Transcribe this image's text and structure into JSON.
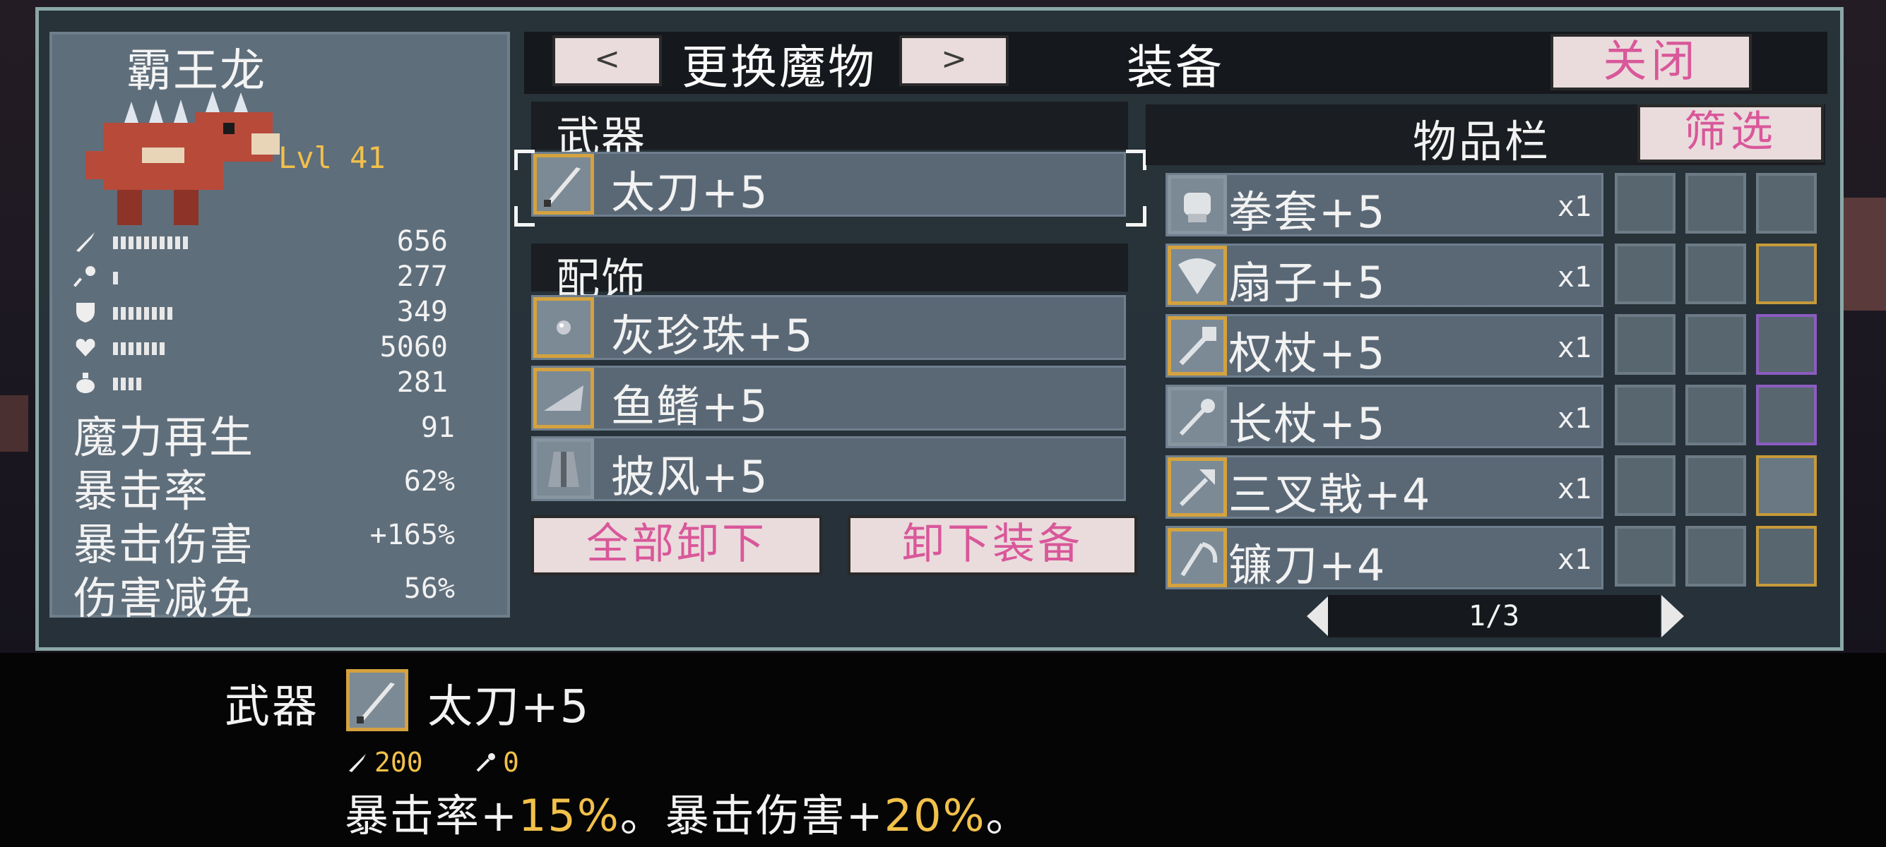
{
  "monster": {
    "name": "霸王龙",
    "level": "Lvl 41",
    "stats": [
      {
        "icon": "sword-icon",
        "value": "656",
        "bar_fraction": 0.55
      },
      {
        "icon": "staff-icon",
        "value": "277",
        "bar_fraction": 0.07
      },
      {
        "icon": "shield-icon",
        "value": "349",
        "bar_fraction": 0.45
      },
      {
        "icon": "heart-icon",
        "value": "5060",
        "bar_fraction": 0.38
      },
      {
        "icon": "potion-icon",
        "value": "281",
        "bar_fraction": 0.2
      }
    ],
    "extra": [
      {
        "label": "魔力再生",
        "value": "91"
      },
      {
        "label": "暴击率",
        "value": "62%"
      },
      {
        "label": "暴击伤害",
        "value": "+165%"
      },
      {
        "label": "伤害减免",
        "value": "56%"
      }
    ]
  },
  "topbar": {
    "prev": "<",
    "swap": "更换魔物",
    "next": ">",
    "title": "装备",
    "close": "关闭"
  },
  "equipment": {
    "weapon_header": "武器",
    "weapon": {
      "name": "太刀+5",
      "icon": "katana-icon"
    },
    "accessory_header": "配饰",
    "accessories": [
      {
        "name": "灰珍珠+5",
        "icon": "pearl-icon"
      },
      {
        "name": "鱼鳍+5",
        "icon": "fin-icon"
      },
      {
        "name": "披风+5",
        "icon": "cape-icon"
      }
    ],
    "unequip_all": "全部卸下",
    "unequip": "卸下装备"
  },
  "inventory": {
    "label": "物品栏",
    "filter": "筛选",
    "items": [
      {
        "name": "拳套+5",
        "qty": "x1",
        "icon": "gauntlet-icon",
        "gold": false
      },
      {
        "name": "扇子+5",
        "qty": "x1",
        "icon": "fan-icon",
        "gold": true
      },
      {
        "name": "权杖+5",
        "qty": "x1",
        "icon": "scepter-icon",
        "gold": true
      },
      {
        "name": "长杖+5",
        "qty": "x1",
        "icon": "staff-icon",
        "gold": false
      },
      {
        "name": "三叉戟+4",
        "qty": "x1",
        "icon": "trident-icon",
        "gold": true
      },
      {
        "name": "镰刀+4",
        "qty": "x1",
        "icon": "scythe-icon",
        "gold": true
      }
    ],
    "page": "1/3"
  },
  "detail": {
    "category": "武器",
    "name": "太刀+5",
    "attack": "200",
    "magic": "0",
    "desc_part1": "暴击率+",
    "desc_val1": "15%",
    "desc_part2": "。暴击伤害+",
    "desc_val2": "20%",
    "desc_part3": "。"
  },
  "colors": {
    "accent_pink": "#d9579a",
    "gold_border": "#d4a23e",
    "highlight_yellow": "#f2c14a"
  }
}
